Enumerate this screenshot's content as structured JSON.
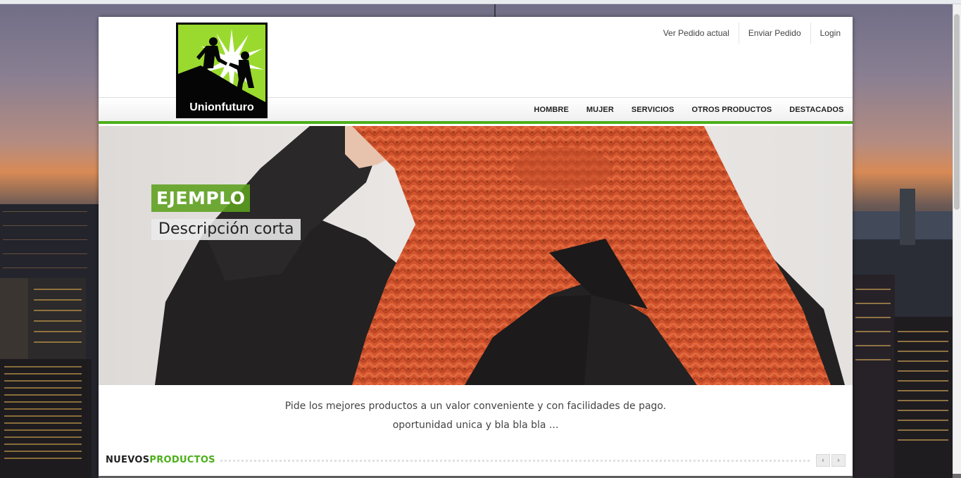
{
  "logo": {
    "text": "Unionfuturo",
    "icon": "climbers-logo-icon"
  },
  "toplinks": [
    {
      "label": "Ver Pedido actual"
    },
    {
      "label": "Enviar Pedido"
    },
    {
      "label": "Login"
    }
  ],
  "nav": [
    {
      "label": "HOMBRE"
    },
    {
      "label": "MUJER"
    },
    {
      "label": "SERVICIOS"
    },
    {
      "label": "OTROS PRODUCTOS"
    },
    {
      "label": "DESTACADOS"
    }
  ],
  "hero": {
    "title": "EJEMPLO",
    "subtitle": "Descripción corta",
    "image": "woman-wearing-orange-knit-scarf"
  },
  "tagline": {
    "line1": "Pide los mejores productos a un valor conveniente y con facilidades de pago.",
    "line2": "oportunidad unica y bla bla bla ..."
  },
  "section": {
    "title_part1": "NUEVOS",
    "title_part2": "PRODUCTOS",
    "prev_icon": "chevron-left-icon",
    "next_icon": "chevron-right-icon",
    "prev_glyph": "‹",
    "next_glyph": "›"
  },
  "colors": {
    "accent": "#4caf1a",
    "logo_green": "#9ada2e",
    "scarf": "#d2542f"
  }
}
